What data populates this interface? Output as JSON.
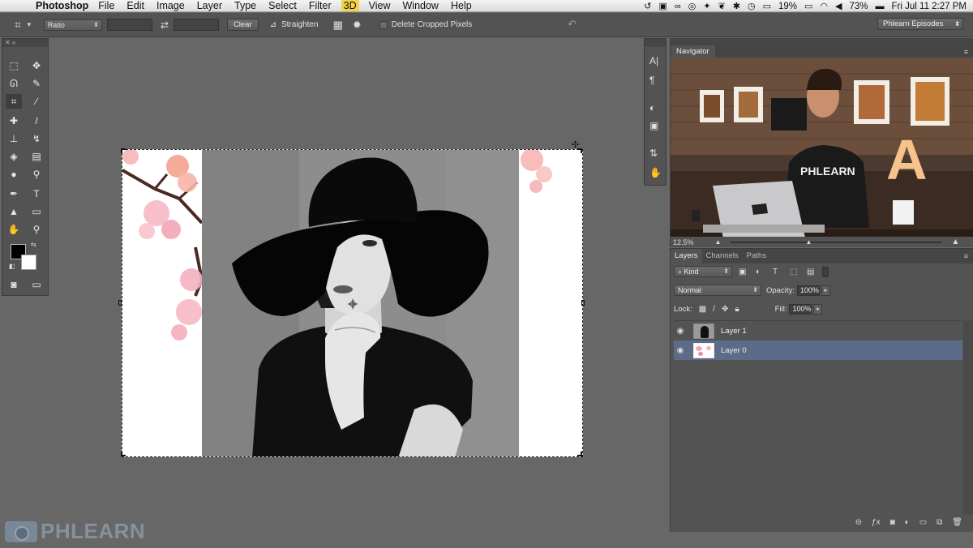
{
  "menubar": {
    "app": "Photoshop",
    "items": [
      "File",
      "Edit",
      "Image",
      "Layer",
      "Type",
      "Select",
      "Filter",
      "3D",
      "View",
      "Window",
      "Help"
    ],
    "active_item": "3D",
    "battery_left": "19%",
    "battery_right": "73%",
    "datetime": "Fri Jul 11  2:27 PM"
  },
  "options": {
    "ratio": "Ratio",
    "clear": "Clear",
    "straighten": "Straighten",
    "delete_cropped": "Delete Cropped Pixels",
    "workspace": "Phlearn Episodes"
  },
  "navigator": {
    "tab": "Navigator",
    "zoom": "12.5%"
  },
  "layers": {
    "tabs": [
      "Layers",
      "Channels",
      "Paths"
    ],
    "filter_kind": "Kind",
    "blend_mode": "Normal",
    "opacity_label": "Opacity:",
    "opacity": "100%",
    "lock_label": "Lock:",
    "fill_label": "Fill:",
    "fill": "100%",
    "items": [
      {
        "name": "Layer 1",
        "selected": false
      },
      {
        "name": "Layer 0",
        "selected": true
      }
    ]
  },
  "watermark": "PHLEARN",
  "video_shirt_text": "PHLEARN",
  "video_letter": "A",
  "colors": {
    "selected_layer": "#5b6b88",
    "panel": "#535353",
    "canvas_bg": "#676767",
    "menu_highlight": "#f2d34a"
  }
}
